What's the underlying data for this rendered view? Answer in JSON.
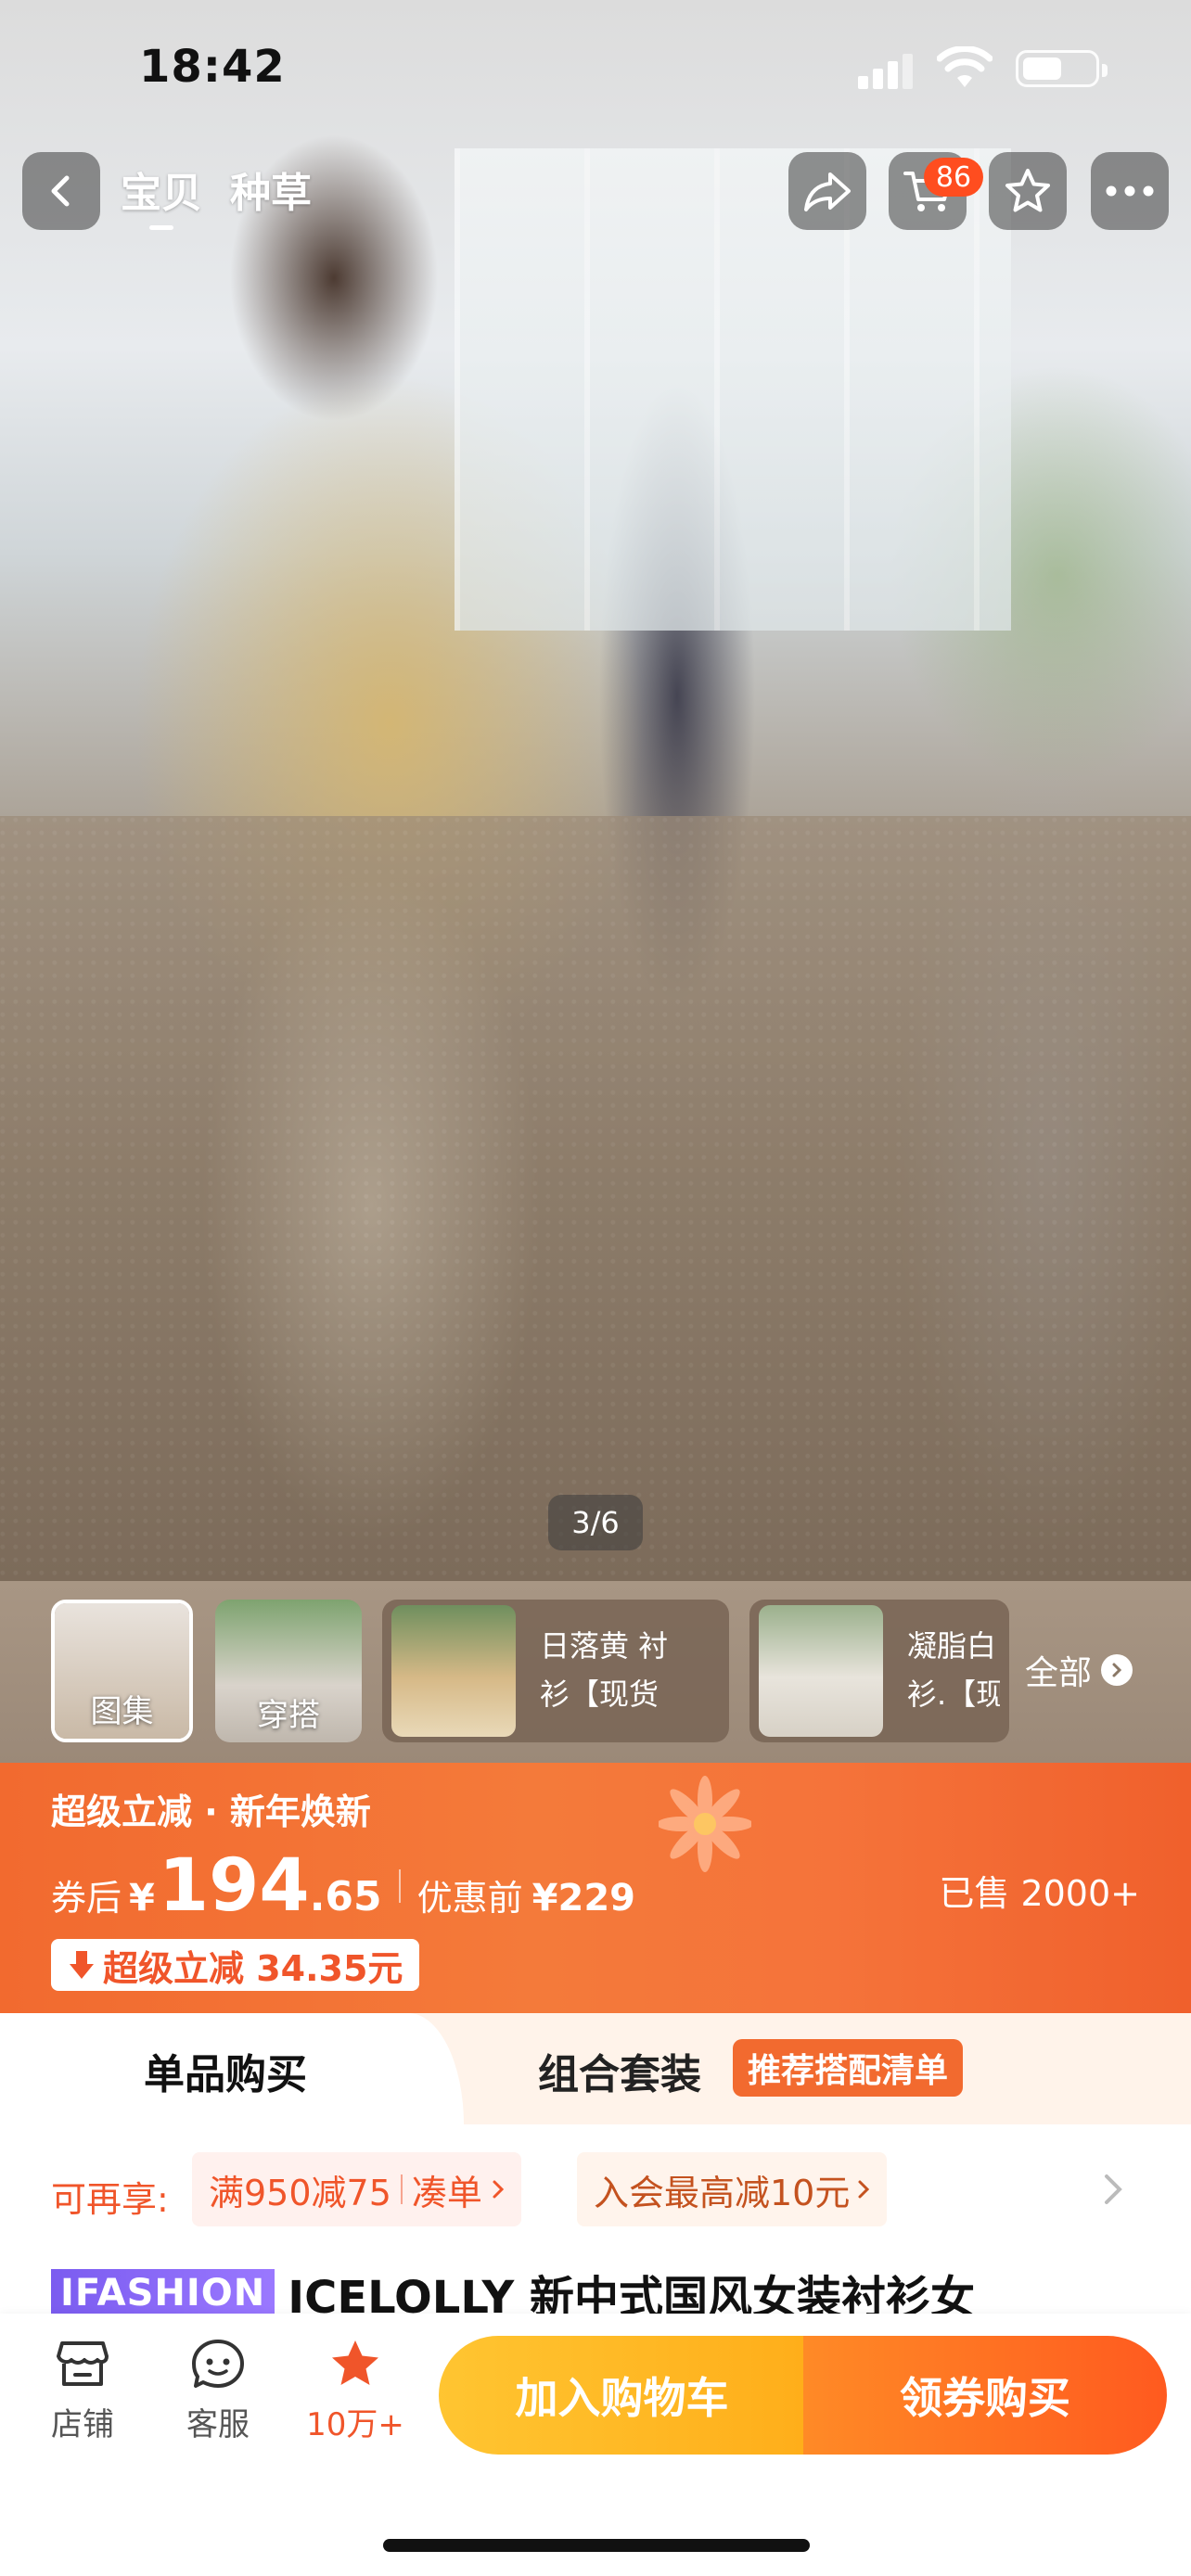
{
  "status_bar": {
    "time": "18:42",
    "battery_level": 0.55
  },
  "nav": {
    "tabs": [
      {
        "label": "宝贝",
        "active": true
      },
      {
        "label": "种草",
        "active": false
      }
    ],
    "cart_count": "86"
  },
  "gallery": {
    "indicator": "3/6"
  },
  "thumbs": [
    {
      "label": "图集",
      "selected": true
    },
    {
      "label": "穿搭",
      "selected": false
    }
  ],
  "variants": [
    {
      "line1": "日落黄 衬",
      "line2": "衫【现货"
    },
    {
      "line1": "凝脂白",
      "line2": "衫.【现"
    }
  ],
  "view_all": "全部",
  "promo": {
    "title": "超级立减 · 新年焕新",
    "after_coupon_label": "券后",
    "currency": "¥",
    "price_int": "194",
    "price_dec": ".65",
    "before_label": "优惠前",
    "original_price": "¥229",
    "sold": "已售 2000+",
    "reduction": "超级立减 34.35元"
  },
  "purchase_tabs": {
    "single": "单品购买",
    "bundle": "组合套装",
    "recommend": "推荐搭配清单"
  },
  "coupons": {
    "extra_label": "可再享:",
    "c1_main": "满950减75",
    "c1_action": "凑单",
    "c2": "入会最高减10元"
  },
  "product": {
    "badge": "IFASHION",
    "title": "ICELOLLY 新中式国风女装衬衫女"
  },
  "bottom_bar": {
    "store": "店铺",
    "service": "客服",
    "favorites": "10万+",
    "add_to_cart": "加入购物车",
    "buy": "领券购买"
  },
  "colors": {
    "accent": "#f26a2f",
    "cart_button": "#ffb823",
    "buy_button": "#ff6a1f"
  }
}
